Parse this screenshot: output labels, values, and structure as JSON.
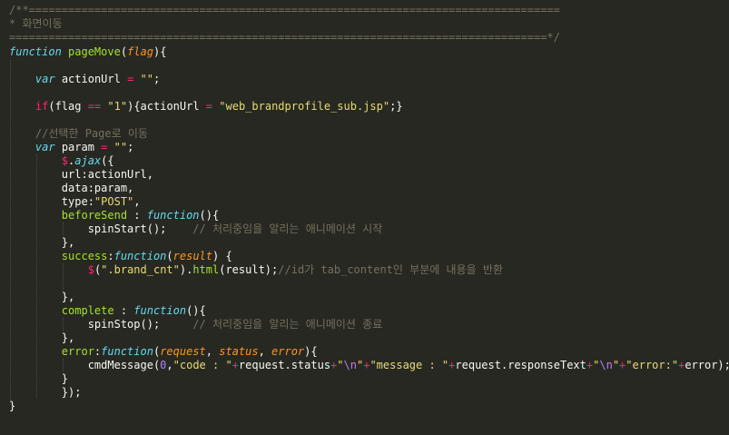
{
  "editor": {
    "theme": {
      "background": "#272822",
      "comment": "#75715e",
      "text": "#f8f8f2",
      "keyword": "#66d9ef",
      "function_name": "#a6e22e",
      "string": "#e6db74",
      "operator": "#f92672",
      "parameter": "#fd971f",
      "number": "#ae81ff"
    },
    "lines": [
      [
        {
          "c": "cmt",
          "t": "/**================================================================================="
        }
      ],
      [
        {
          "c": "cmt",
          "t": "* 화면이동"
        }
      ],
      [
        {
          "c": "cmt",
          "t": "==================================================================================*/"
        }
      ],
      [
        {
          "c": "kw",
          "t": "function"
        },
        {
          "c": "txt",
          "t": " "
        },
        {
          "c": "fn",
          "t": "pageMove"
        },
        {
          "c": "txt",
          "t": "("
        },
        {
          "c": "prm",
          "t": "flag"
        },
        {
          "c": "txt",
          "t": "){"
        }
      ],
      [],
      [
        {
          "c": "txt",
          "t": "    "
        },
        {
          "c": "kw",
          "t": "var"
        },
        {
          "c": "txt",
          "t": " actionUrl "
        },
        {
          "c": "op",
          "t": "="
        },
        {
          "c": "txt",
          "t": " "
        },
        {
          "c": "str",
          "t": "\"\""
        },
        {
          "c": "txt",
          "t": ";"
        }
      ],
      [],
      [
        {
          "c": "txt",
          "t": "    "
        },
        {
          "c": "op",
          "t": "if"
        },
        {
          "c": "txt",
          "t": "(flag "
        },
        {
          "c": "op",
          "t": "=="
        },
        {
          "c": "txt",
          "t": " "
        },
        {
          "c": "str",
          "t": "\"1\""
        },
        {
          "c": "txt",
          "t": "){actionUrl "
        },
        {
          "c": "op",
          "t": "="
        },
        {
          "c": "txt",
          "t": " "
        },
        {
          "c": "str",
          "t": "\"web_brandprofile_sub.jsp\""
        },
        {
          "c": "txt",
          "t": ";}"
        }
      ],
      [],
      [
        {
          "c": "txt",
          "t": "    "
        },
        {
          "c": "cmt",
          "t": "//선택한 Page로 이동"
        }
      ],
      [
        {
          "c": "txt",
          "t": "    "
        },
        {
          "c": "kw",
          "t": "var"
        },
        {
          "c": "txt",
          "t": " param "
        },
        {
          "c": "op",
          "t": "="
        },
        {
          "c": "txt",
          "t": " "
        },
        {
          "c": "str",
          "t": "\"\""
        },
        {
          "c": "txt",
          "t": ";"
        }
      ],
      [
        {
          "c": "txt",
          "t": "        "
        },
        {
          "c": "op",
          "t": "$"
        },
        {
          "c": "txt",
          "t": "."
        },
        {
          "c": "ref",
          "t": "ajax"
        },
        {
          "c": "txt",
          "t": "({"
        }
      ],
      [
        {
          "c": "txt",
          "t": "        url:actionUrl,"
        }
      ],
      [
        {
          "c": "txt",
          "t": "        data:param,"
        }
      ],
      [
        {
          "c": "txt",
          "t": "        type:"
        },
        {
          "c": "str",
          "t": "\"POST\""
        },
        {
          "c": "txt",
          "t": ","
        }
      ],
      [
        {
          "c": "txt",
          "t": "        "
        },
        {
          "c": "fn",
          "t": "beforeSend"
        },
        {
          "c": "txt",
          "t": " : "
        },
        {
          "c": "kw",
          "t": "function"
        },
        {
          "c": "txt",
          "t": "(){"
        }
      ],
      [
        {
          "c": "txt",
          "t": "            spinStart();    "
        },
        {
          "c": "cmt",
          "t": "// 처리중임을 알리는 애니메이션 시작"
        }
      ],
      [
        {
          "c": "txt",
          "t": "        },"
        }
      ],
      [
        {
          "c": "txt",
          "t": "        "
        },
        {
          "c": "fn",
          "t": "success"
        },
        {
          "c": "txt",
          "t": ":"
        },
        {
          "c": "kw",
          "t": "function"
        },
        {
          "c": "txt",
          "t": "("
        },
        {
          "c": "prm",
          "t": "result"
        },
        {
          "c": "txt",
          "t": ") {"
        }
      ],
      [
        {
          "c": "txt",
          "t": "            "
        },
        {
          "c": "op",
          "t": "$"
        },
        {
          "c": "txt",
          "t": "("
        },
        {
          "c": "str",
          "t": "\".brand_cnt\""
        },
        {
          "c": "txt",
          "t": ")."
        },
        {
          "c": "fn",
          "t": "html"
        },
        {
          "c": "txt",
          "t": "(result);"
        },
        {
          "c": "cmt",
          "t": "//id가 tab_content인 부분에 내용을 반환"
        }
      ],
      [],
      [
        {
          "c": "txt",
          "t": "        },"
        }
      ],
      [
        {
          "c": "txt",
          "t": "        "
        },
        {
          "c": "fn",
          "t": "complete"
        },
        {
          "c": "txt",
          "t": " : "
        },
        {
          "c": "kw",
          "t": "function"
        },
        {
          "c": "txt",
          "t": "(){"
        }
      ],
      [
        {
          "c": "txt",
          "t": "            spinStop();     "
        },
        {
          "c": "cmt",
          "t": "// 처리중임을 알리는 애니메이션 종료"
        }
      ],
      [
        {
          "c": "txt",
          "t": "        },"
        }
      ],
      [
        {
          "c": "txt",
          "t": "        "
        },
        {
          "c": "fn",
          "t": "error"
        },
        {
          "c": "txt",
          "t": ":"
        },
        {
          "c": "kw",
          "t": "function"
        },
        {
          "c": "txt",
          "t": "("
        },
        {
          "c": "prm",
          "t": "request"
        },
        {
          "c": "txt",
          "t": ", "
        },
        {
          "c": "prm",
          "t": "status"
        },
        {
          "c": "txt",
          "t": ", "
        },
        {
          "c": "prm",
          "t": "error"
        },
        {
          "c": "txt",
          "t": "){"
        }
      ],
      [
        {
          "c": "txt",
          "t": "            cmdMessage("
        },
        {
          "c": "num",
          "t": "0"
        },
        {
          "c": "txt",
          "t": ","
        },
        {
          "c": "str",
          "t": "\"code : \""
        },
        {
          "c": "op",
          "t": "+"
        },
        {
          "c": "txt",
          "t": "request.status"
        },
        {
          "c": "op",
          "t": "+"
        },
        {
          "c": "str",
          "t": "\""
        },
        {
          "c": "num",
          "t": "\\n"
        },
        {
          "c": "str",
          "t": "\""
        },
        {
          "c": "op",
          "t": "+"
        },
        {
          "c": "str",
          "t": "\"message : \""
        },
        {
          "c": "op",
          "t": "+"
        },
        {
          "c": "txt",
          "t": "request.responseText"
        },
        {
          "c": "op",
          "t": "+"
        },
        {
          "c": "str",
          "t": "\""
        },
        {
          "c": "num",
          "t": "\\n"
        },
        {
          "c": "str",
          "t": "\""
        },
        {
          "c": "op",
          "t": "+"
        },
        {
          "c": "str",
          "t": "\"error:\""
        },
        {
          "c": "op",
          "t": "+"
        },
        {
          "c": "txt",
          "t": "error);"
        }
      ],
      [
        {
          "c": "txt",
          "t": "        }"
        }
      ],
      [
        {
          "c": "txt",
          "t": "        });"
        }
      ],
      [
        {
          "c": "txt",
          "t": "}"
        }
      ]
    ]
  }
}
